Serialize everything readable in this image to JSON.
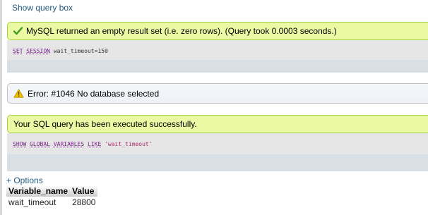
{
  "links": {
    "show_query_box": "Show query box",
    "options": "+ Options"
  },
  "messages": [
    {
      "type": "success",
      "text": "MySQL returned an empty result set (i.e. zero rows). (Query took 0.0003 seconds.)",
      "icon": "check-icon"
    },
    {
      "type": "error",
      "text": "Error: #1046 No database selected",
      "icon": "warning-icon"
    },
    {
      "type": "success",
      "text": "Your SQL query has been executed successfully."
    }
  ],
  "queries": [
    {
      "kw1": "SET",
      "kw2": "SESSION",
      "rest": "wait_timeout=150"
    },
    {
      "kw1": "SHOW",
      "kw2": "GLOBAL",
      "kw3": "VARIABLES",
      "kw4": "LIKE",
      "string": "'wait_timeout'"
    }
  ],
  "result_table": {
    "headers": [
      "Variable_name",
      "Value"
    ],
    "rows": [
      [
        "wait_timeout",
        "28800"
      ]
    ]
  },
  "colors": {
    "success_bg": "#ebf8a4",
    "success_border": "#a2d246",
    "link": "#235a81",
    "sql_keyword": "#7a1f8b",
    "sql_string": "#b0246a",
    "sql_box_bg": "#e6e6e6",
    "sql_tools_bg": "#d8dfe5"
  }
}
